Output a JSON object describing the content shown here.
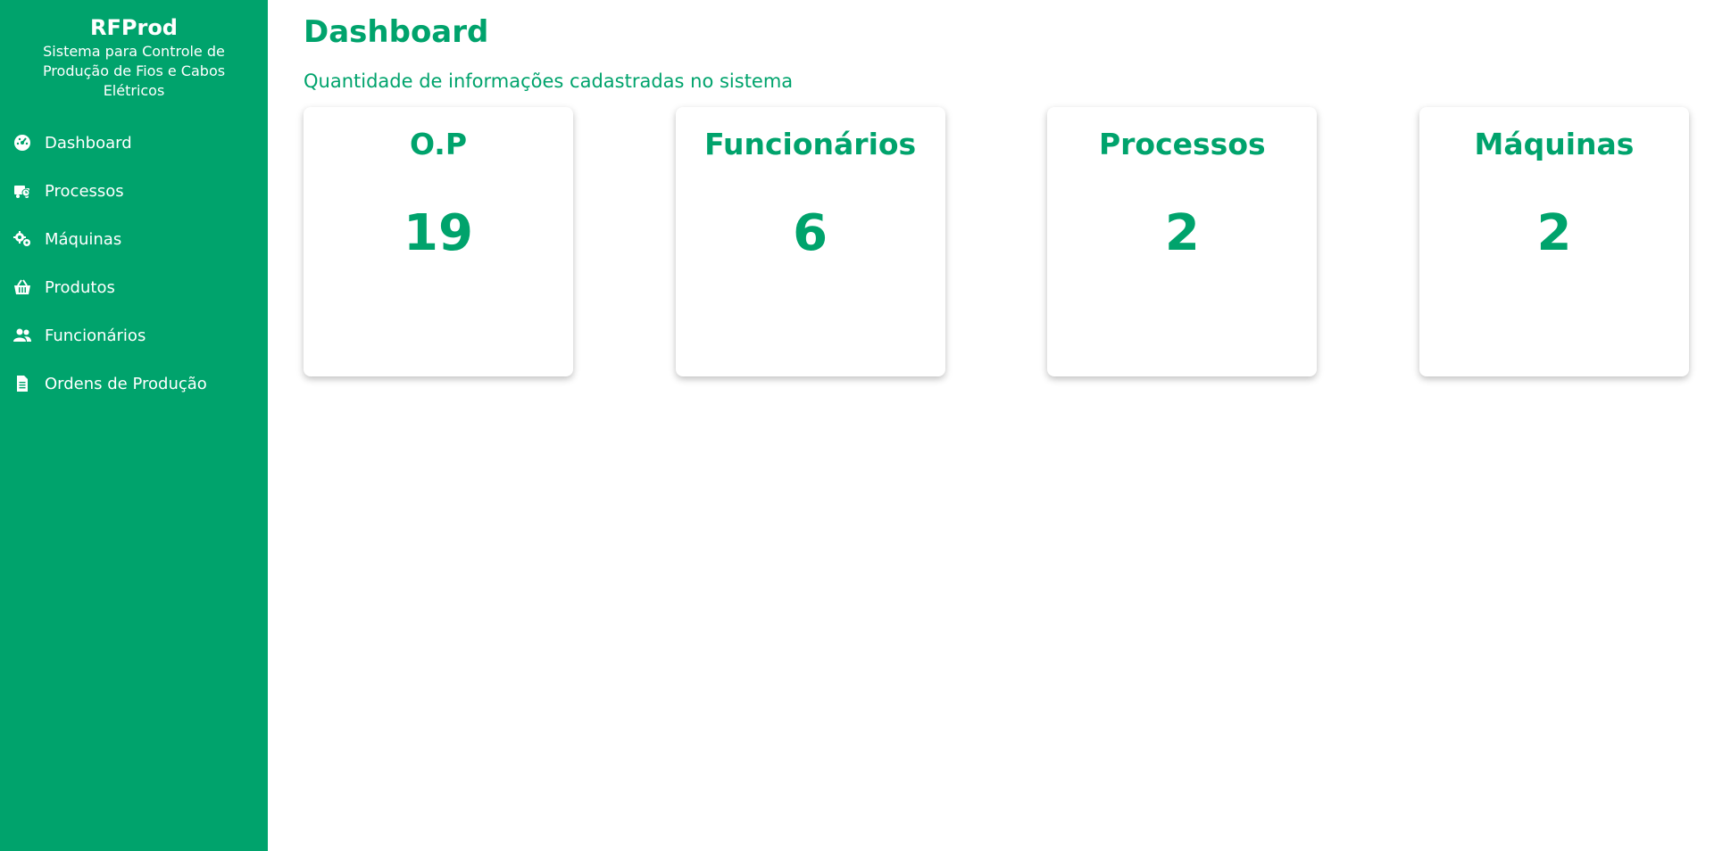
{
  "sidebar": {
    "brand_title": "RFProd",
    "brand_subtitle": "Sistema para Controle de Produção de Fios e Cabos Elétricos",
    "items": [
      {
        "label": "Dashboard",
        "icon": "dashboard-gauge-icon"
      },
      {
        "label": "Processos",
        "icon": "truck-clock-icon"
      },
      {
        "label": "Máquinas",
        "icon": "gears-icon"
      },
      {
        "label": "Produtos",
        "icon": "basket-icon"
      },
      {
        "label": "Funcionários",
        "icon": "users-icon"
      },
      {
        "label": "Ordens de Produção",
        "icon": "document-icon"
      }
    ]
  },
  "main": {
    "title": "Dashboard",
    "subtitle": "Quantidade de informações cadastradas no sistema",
    "cards": [
      {
        "title": "O.P",
        "value": "19"
      },
      {
        "title": "Funcionários",
        "value": "6"
      },
      {
        "title": "Processos",
        "value": "2"
      },
      {
        "title": "Máquinas",
        "value": "2"
      }
    ]
  },
  "colors": {
    "brand_green": "#00a36c",
    "background": "#ffffff"
  }
}
